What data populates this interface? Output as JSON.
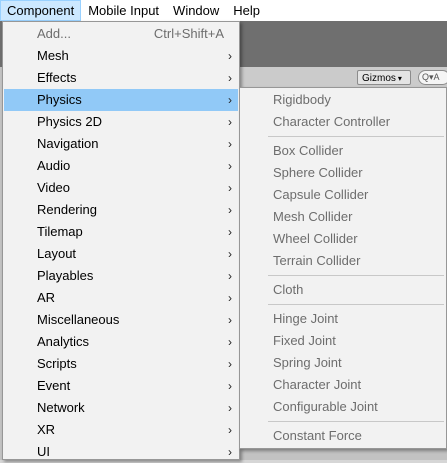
{
  "menubar": {
    "items": [
      "Component",
      "Mobile Input",
      "Window",
      "Help"
    ]
  },
  "scene": {
    "gizmos_label": "Gizmos",
    "gizmos_caret": "▾",
    "search_hint": "Q▾A"
  },
  "component_menu": {
    "items": [
      {
        "label": "Add...",
        "shortcut": "Ctrl+Shift+A",
        "submenu": false,
        "disabled": true
      },
      {
        "label": "Mesh",
        "submenu": true
      },
      {
        "label": "Effects",
        "submenu": true
      },
      {
        "label": "Physics",
        "submenu": true,
        "selected": true
      },
      {
        "label": "Physics 2D",
        "submenu": true
      },
      {
        "label": "Navigation",
        "submenu": true
      },
      {
        "label": "Audio",
        "submenu": true
      },
      {
        "label": "Video",
        "submenu": true
      },
      {
        "label": "Rendering",
        "submenu": true
      },
      {
        "label": "Tilemap",
        "submenu": true
      },
      {
        "label": "Layout",
        "submenu": true
      },
      {
        "label": "Playables",
        "submenu": true
      },
      {
        "label": "AR",
        "submenu": true
      },
      {
        "label": "Miscellaneous",
        "submenu": true
      },
      {
        "label": "Analytics",
        "submenu": true
      },
      {
        "label": "Scripts",
        "submenu": true
      },
      {
        "label": "Event",
        "submenu": true
      },
      {
        "label": "Network",
        "submenu": true
      },
      {
        "label": "XR",
        "submenu": true
      },
      {
        "label": "UI",
        "submenu": true
      }
    ],
    "arrow_glyph": "›"
  },
  "physics_submenu": {
    "groups": [
      [
        "Rigidbody",
        "Character Controller"
      ],
      [
        "Box Collider",
        "Sphere Collider",
        "Capsule Collider",
        "Mesh Collider",
        "Wheel Collider",
        "Terrain Collider"
      ],
      [
        "Cloth"
      ],
      [
        "Hinge Joint",
        "Fixed Joint",
        "Spring Joint",
        "Character Joint",
        "Configurable Joint"
      ],
      [
        "Constant Force"
      ]
    ]
  },
  "colors": {
    "selected_bg": "#91c9f7",
    "menubar_active_bg": "#cce8ff",
    "disabled_text": "#6d6d6d"
  }
}
